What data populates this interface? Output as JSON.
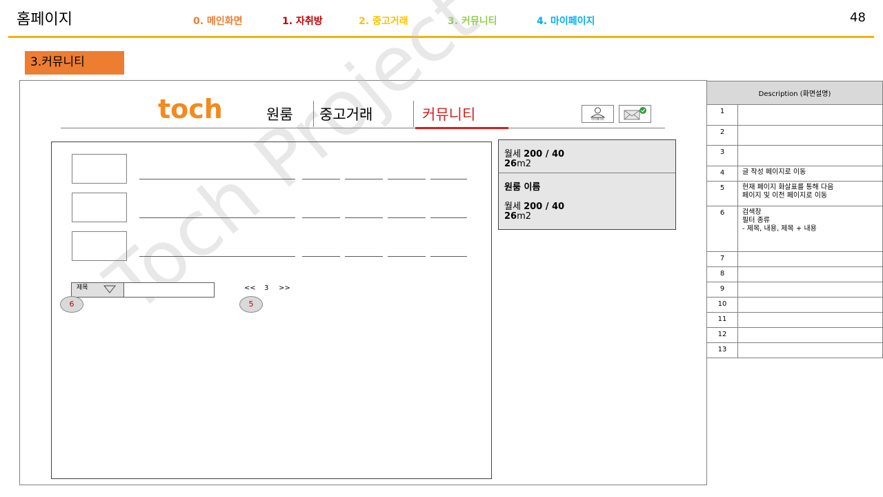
{
  "slide": {
    "title": "홈페이지",
    "page_number": "48",
    "section_label": "3.커뮤니티"
  },
  "top_nav": [
    {
      "label": "0. 메인화면",
      "color": "#ed7d31"
    },
    {
      "label": "1. 자취방",
      "color": "#c00000"
    },
    {
      "label": "2. 중고거래",
      "color": "#ffc000"
    },
    {
      "label": "3. 커뮤니티",
      "color": "#92d050"
    },
    {
      "label": "4. 마이페이지",
      "color": "#00b0f0"
    }
  ],
  "site": {
    "logo": "toch",
    "nav": [
      {
        "label": "원룸"
      },
      {
        "label": "중고거래"
      },
      {
        "label": "커뮤니티",
        "active": true
      }
    ],
    "mypage_icon_label": "마이페이지",
    "accent_color": "#f28a1f",
    "active_underline_color": "#d42020"
  },
  "search": {
    "filter_selected": "제목"
  },
  "pagination": {
    "prev": "<<",
    "current": "3",
    "next": ">>"
  },
  "markers": {
    "search": "6",
    "pagination": "5"
  },
  "detail_panel": {
    "top": {
      "price_prefix": "월세",
      "price": "200 / 40",
      "area_num": "26",
      "area_unit": "m2"
    },
    "name": "원룸 이름",
    "bottom": {
      "price_prefix": "월세",
      "price": "200 / 40",
      "area_num": "26",
      "area_unit": "m2"
    }
  },
  "watermark": "Toch Project",
  "description": {
    "header": "Description (화면설명)",
    "rows": [
      {
        "num": "1",
        "text": ""
      },
      {
        "num": "2",
        "text": ""
      },
      {
        "num": "3",
        "text": ""
      },
      {
        "num": "4",
        "text": "글 작성 페이지로 이동"
      },
      {
        "num": "5",
        "text": "현재 페이지 화살표를 통해 다음\n페이지 및 이전 페이지로 이동"
      },
      {
        "num": "6",
        "text": "검색창\n필터 종류\n-  제목, 내용, 제목 + 내용"
      },
      {
        "num": "7",
        "text": ""
      },
      {
        "num": "8",
        "text": ""
      },
      {
        "num": "9",
        "text": ""
      },
      {
        "num": "10",
        "text": ""
      },
      {
        "num": "11",
        "text": ""
      },
      {
        "num": "12",
        "text": ""
      },
      {
        "num": "13",
        "text": ""
      }
    ]
  }
}
